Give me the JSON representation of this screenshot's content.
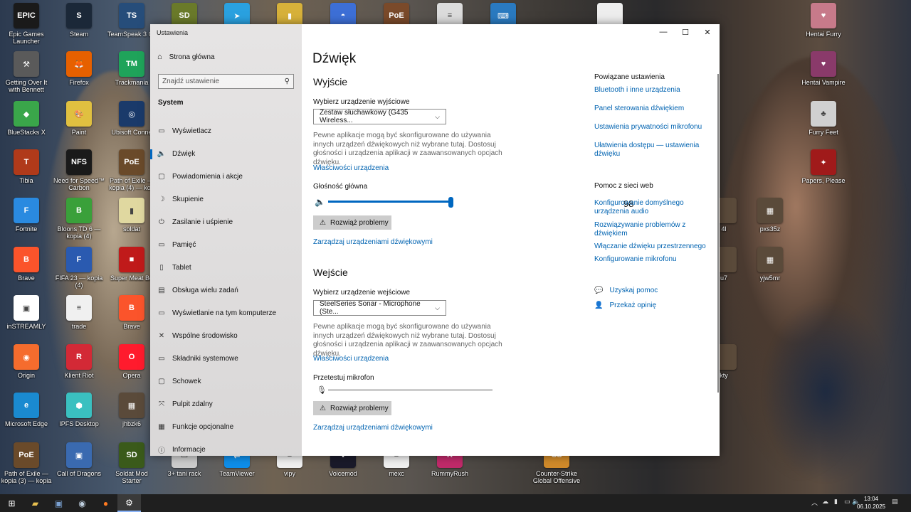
{
  "desktop_icons": [
    {
      "label": "Epic Games Launcher",
      "color": "#1a1a1a",
      "glyph": "EPIC"
    },
    {
      "label": "Steam",
      "color": "#1b2838",
      "glyph": "S"
    },
    {
      "label": "TeamSpeak 3 Cli",
      "color": "#264d7a",
      "glyph": "TS"
    },
    {
      "label": "",
      "color": "#6a7a2a",
      "glyph": "SD"
    },
    {
      "label": "",
      "color": "#2aa1e0",
      "glyph": "➤"
    },
    {
      "label": "",
      "color": "#d7b13a",
      "glyph": "▮"
    },
    {
      "label": "",
      "color": "#3d6fd6",
      "glyph": "◓"
    },
    {
      "label": "",
      "color": "#7a4a2a",
      "glyph": "PoE"
    },
    {
      "label": "",
      "color": "#dcdcdc",
      "glyph": "≡"
    },
    {
      "label": "",
      "color": "#2a7ac0",
      "glyph": "⌨"
    },
    {
      "label": "",
      "color": "#eeeeee",
      "glyph": ""
    },
    {
      "label": "Hentai Furry",
      "color": "#c77a8a",
      "glyph": "♥"
    },
    {
      "label": "Getting Over It with Bennett Foddy",
      "color": "#5a5a5a",
      "glyph": "⚒"
    },
    {
      "label": "Firefox",
      "color": "#e66000",
      "glyph": "🦊"
    },
    {
      "label": "Trackmania",
      "color": "#1fa35a",
      "glyph": "TM"
    },
    {
      "label": "Hentai Vampire",
      "color": "#8a3a6a",
      "glyph": "♥"
    },
    {
      "label": "BlueStacks X",
      "color": "#3aa64a",
      "glyph": "◆"
    },
    {
      "label": "Paint",
      "color": "#e0c040",
      "glyph": "🎨"
    },
    {
      "label": "Ubisoft Conne",
      "color": "#1a3a6a",
      "glyph": "◎"
    },
    {
      "label": "Furry Feet",
      "color": "#d0d0d0",
      "glyph": "♣"
    },
    {
      "label": "Tibia",
      "color": "#b03a1a",
      "glyph": "T"
    },
    {
      "label": "Need for Speed™ Carbon",
      "color": "#1a1a1a",
      "glyph": "NFS"
    },
    {
      "label": "Path of Exile — kopia (4) — kop",
      "color": "#6a4a2a",
      "glyph": "PoE"
    },
    {
      "label": "Papers, Please",
      "color": "#a01a1a",
      "glyph": "✦"
    },
    {
      "label": "Fortnite",
      "color": "#2a8ae0",
      "glyph": "F"
    },
    {
      "label": "Bloons TD 6 — kopia (4)",
      "color": "#3aa03a",
      "glyph": "B"
    },
    {
      "label": "soldat",
      "color": "#e0d8a0",
      "glyph": "▮"
    },
    {
      "label": "pxs35z",
      "color": "#5a4a3a",
      "glyph": "▦"
    },
    {
      "label": "Brave",
      "color": "#fb542b",
      "glyph": "B"
    },
    {
      "label": "FIFA 23 — kopia (4)",
      "color": "#2a5ab0",
      "glyph": "F"
    },
    {
      "label": "Super Meat Bo",
      "color": "#c01a1a",
      "glyph": "■"
    },
    {
      "label": "yjw5mr",
      "color": "#5a4a3a",
      "glyph": "▦"
    },
    {
      "label": "inSTREAMLY",
      "color": "#ffffff",
      "glyph": "▣"
    },
    {
      "label": "trade",
      "color": "#f0f0f0",
      "glyph": "≡"
    },
    {
      "label": "Brave",
      "color": "#fb542b",
      "glyph": "B"
    },
    {
      "label": "Origin",
      "color": "#f56c2d",
      "glyph": "◉"
    },
    {
      "label": "Klient Riot",
      "color": "#d32936",
      "glyph": "R"
    },
    {
      "label": "Opera",
      "color": "#ff1b2d",
      "glyph": "O"
    },
    {
      "label": "Microsoft Edge",
      "color": "#1a8ad0",
      "glyph": "e"
    },
    {
      "label": "IPFS Desktop",
      "color": "#3ac0c0",
      "glyph": "⬢"
    },
    {
      "label": "jhbzk6",
      "color": "#5a4a3a",
      "glyph": "▦"
    },
    {
      "label": "Path of Exile — kopia (3) — kopia",
      "color": "#6a4a2a",
      "glyph": "PoE"
    },
    {
      "label": "Call of Dragons",
      "color": "#3a6ab0",
      "glyph": "▣"
    },
    {
      "label": "Soldat Mod Starter",
      "color": "#3a5a1a",
      "glyph": "SD"
    },
    {
      "label": "3+ tani rack",
      "color": "#cccccc",
      "glyph": "▭"
    },
    {
      "label": "TeamViewer",
      "color": "#0e8ee9",
      "glyph": "⇄"
    },
    {
      "label": "vipy",
      "color": "#f0f0f0",
      "glyph": "≡"
    },
    {
      "label": "Voicemod",
      "color": "#1a1a2a",
      "glyph": "V"
    },
    {
      "label": "mexc",
      "color": "#f0f0f0",
      "glyph": "≡"
    },
    {
      "label": "RummyRush",
      "color": "#c02a6a",
      "glyph": "R"
    },
    {
      "label": "Counter-Strike Global Offensive",
      "color": "#d08a2a",
      "glyph": "CS"
    },
    {
      "label": "4l",
      "color": "#5a4a3a",
      "glyph": ""
    },
    {
      "label": "u7",
      "color": "#5a4a3a",
      "glyph": ""
    },
    {
      "label": "kty",
      "color": "#5a4a3a",
      "glyph": ""
    }
  ],
  "window": {
    "title": "Ustawienia",
    "minimize": "—",
    "maximize": "☐",
    "close": "✕"
  },
  "sidebar": {
    "home_label": "Strona główna",
    "home_icon": "home-icon",
    "search_placeholder": "Znajdź ustawienie",
    "section": "System",
    "items": [
      {
        "label": "Wyświetlacz",
        "icon": "display-icon",
        "glyph": "▭"
      },
      {
        "label": "Dźwięk",
        "icon": "sound-icon",
        "glyph": "🔈",
        "selected": true
      },
      {
        "label": "Powiadomienia i akcje",
        "icon": "notifications-icon",
        "glyph": "▢"
      },
      {
        "label": "Skupienie",
        "icon": "focus-icon",
        "glyph": "☽"
      },
      {
        "label": "Zasilanie i uśpienie",
        "icon": "power-icon",
        "glyph": "⏻"
      },
      {
        "label": "Pamięć",
        "icon": "storage-icon",
        "glyph": "▭"
      },
      {
        "label": "Tablet",
        "icon": "tablet-icon",
        "glyph": "▯"
      },
      {
        "label": "Obsługa wielu zadań",
        "icon": "multitasking-icon",
        "glyph": "▤"
      },
      {
        "label": "Wyświetlanie na tym komputerze",
        "icon": "project-icon",
        "glyph": "▭"
      },
      {
        "label": "Wspólne środowisko",
        "icon": "shared-icon",
        "glyph": "✕"
      },
      {
        "label": "Składniki systemowe",
        "icon": "components-icon",
        "glyph": "▭"
      },
      {
        "label": "Schowek",
        "icon": "clipboard-icon",
        "glyph": "▢"
      },
      {
        "label": "Pulpit zdalny",
        "icon": "remote-icon",
        "glyph": "⤧"
      },
      {
        "label": "Funkcje opcjonalne",
        "icon": "optional-icon",
        "glyph": "▦"
      },
      {
        "label": "Informacje",
        "icon": "info-icon",
        "glyph": "ⓘ"
      }
    ]
  },
  "main": {
    "title": "Dźwięk",
    "output": {
      "heading": "Wyjście",
      "device_label": "Wybierz urządzenie wyjściowe",
      "device_value": "Zestaw słuchawkowy (G435 Wireless...",
      "note": "Pewne aplikacje mogą być skonfigurowane do używania innych urządzeń dźwiękowych niż wybrane tutaj. Dostosuj głośności i urządzenia aplikacji w zaawansowanych opcjach dźwięku.",
      "properties_link": "Właściwości urządzenia",
      "volume_label": "Głośność główna",
      "volume_value": "98",
      "volume_level": 0.98,
      "troubleshoot": "Rozwiąż problemy",
      "manage_link": "Zarządzaj urządzeniami dźwiękowymi"
    },
    "input": {
      "heading": "Wejście",
      "device_label": "Wybierz urządzenie wejściowe",
      "device_value": "SteelSeries Sonar - Microphone (Ste...",
      "note": "Pewne aplikacje mogą być skonfigurowane do używania innych urządzeń dźwiękowych niż wybrane tutaj. Dostosuj głośności i urządzenia aplikacji w zaawansowanych opcjach dźwięku.",
      "properties_link": "Właściwości urządzenia",
      "test_label": "Przetestuj mikrofon",
      "troubleshoot": "Rozwiąż problemy",
      "manage_link": "Zarządzaj urządzeniami dźwiękowymi"
    }
  },
  "related": {
    "heading": "Powiązane ustawienia",
    "links": [
      "Bluetooth i inne urządzenia",
      "Panel sterowania dźwiękiem",
      "Ustawienia prywatności mikrofonu",
      "Ułatwienia dostępu — ustawienia dźwięku"
    ],
    "web_heading": "Pomoc z sieci web",
    "web_links": [
      "Konfigurowanie domyślnego urządzenia audio",
      "Rozwiązywanie problemów z dźwiękiem",
      "Włączanie dźwięku przestrzennego",
      "Konfigurowanie mikrofonu"
    ],
    "get_help": "Uzyskaj pomoc",
    "feedback": "Przekaż opinię"
  },
  "taskbar": {
    "time": "13:04",
    "date": "06.10.2025"
  },
  "colors": {
    "accent": "#0067c0",
    "link": "#0063b1",
    "taskbar": "#1f1f1f"
  }
}
